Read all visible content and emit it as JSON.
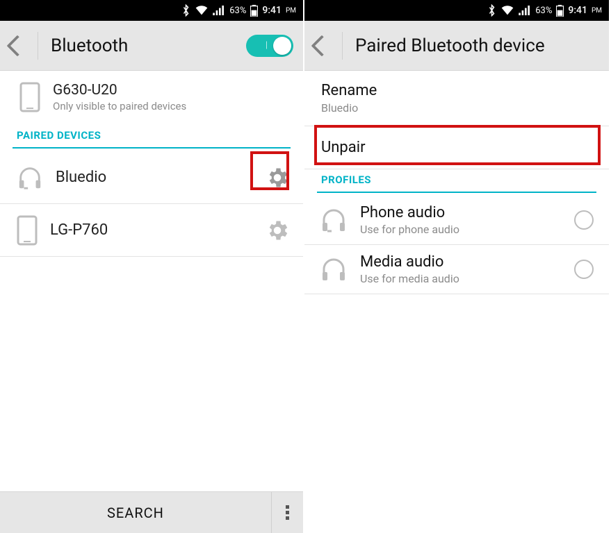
{
  "statusbar": {
    "battery_pct": "63%",
    "time": "9:41",
    "ampm": "PM"
  },
  "left": {
    "header": {
      "title": "Bluetooth",
      "toggle_on": true
    },
    "self_device": {
      "name": "G630-U20",
      "subtitle": "Only visible to paired devices"
    },
    "sections": {
      "paired_label": "PAIRED DEVICES"
    },
    "paired": [
      {
        "name": "Bluedio",
        "icon": "headphones"
      },
      {
        "name": "LG-P760",
        "icon": "phone"
      }
    ],
    "footer": {
      "search": "SEARCH"
    }
  },
  "right": {
    "header": {
      "title": "Paired Bluetooth device"
    },
    "rename": {
      "label": "Rename",
      "value": "Bluedio"
    },
    "unpair": {
      "label": "Unpair"
    },
    "sections": {
      "profiles_label": "PROFILES"
    },
    "profiles": [
      {
        "title": "Phone audio",
        "subtitle": "Use for phone audio",
        "icon": "headset"
      },
      {
        "title": "Media audio",
        "subtitle": "Use for media audio",
        "icon": "headphones"
      }
    ]
  }
}
